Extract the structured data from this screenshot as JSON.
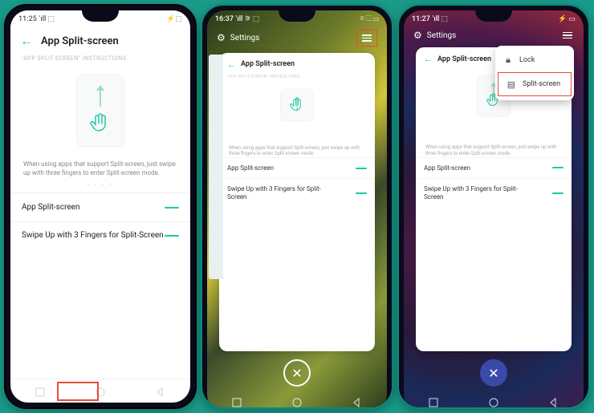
{
  "accent": "#1cc9a8",
  "highlight": "#e74c3c",
  "phones": {
    "p1": {
      "status": {
        "time": "11:25",
        "left_icons": "'ıll ⬚",
        "right_icons": "⚡⬚"
      },
      "header_title": "App Split-screen",
      "instructions_label": "\"APP SPLIT-SCREEN\" INSTRUCTIONS",
      "instruction_text": "When using apps that support Split-screen, just swipe up with three fingers to enter Split-screen mode.",
      "settings": [
        {
          "label": "App Split-screen",
          "on": true
        },
        {
          "label": "Swipe Up with 3 Fingers for Split-Screen",
          "on": true
        }
      ]
    },
    "p2": {
      "status": {
        "time": "16:37",
        "left_icons": "'ıll ⚞ ⬚",
        "right_icons": "⌾ ⬚ ▭"
      },
      "recents_title": "Settings",
      "card": {
        "title": "App Split-screen",
        "instructions_label": "\"APP SPLIT-SCREEN\" INSTRUCTIONS",
        "instruction_text": "When using apps that support Split-screen, just swipe up with three fingers to enter Split-screen mode.",
        "settings": [
          {
            "label": "App Split-screen",
            "on": true
          },
          {
            "label": "Swipe Up with 3 Fingers for Split-Screen",
            "on": true
          }
        ]
      }
    },
    "p3": {
      "status": {
        "time": "11:27",
        "left_icons": "'ıll ⬚",
        "right_icons": "⚡ ▭"
      },
      "recents_title": "Settings",
      "menu": [
        {
          "icon": "lock",
          "label": "Lock"
        },
        {
          "icon": "split",
          "label": "Split-screen"
        }
      ],
      "card": {
        "title": "App Split-screen",
        "instruction_text": "When using apps that support Split-screen, just swipe up with three fingers to enter Split-screen mode.",
        "settings": [
          {
            "label": "App Split-screen",
            "on": true
          },
          {
            "label": "Swipe Up with 3 Fingers for Split-Screen",
            "on": true
          }
        ]
      }
    }
  }
}
